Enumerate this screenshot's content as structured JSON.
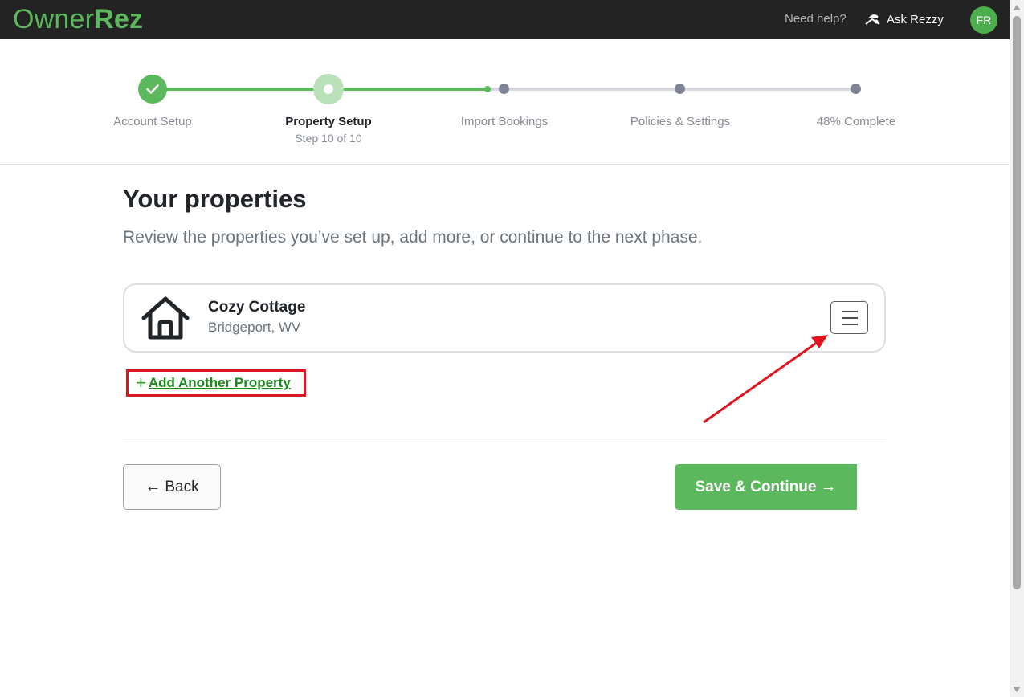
{
  "header": {
    "logo_owner": "Owner",
    "logo_rez": "Rez",
    "help_text": "Need help?",
    "ask_label": "Ask Rezzy",
    "avatar_initials": "FR",
    "brand_color": "#5cb85c"
  },
  "stepper": {
    "steps": [
      {
        "label": "Account Setup",
        "state": "complete"
      },
      {
        "label": "Property Setup",
        "state": "current",
        "sub": "Step 10 of 10"
      },
      {
        "label": "Import Bookings",
        "state": "pending"
      },
      {
        "label": "Policies & Settings",
        "state": "pending"
      },
      {
        "label": "48% Complete",
        "state": "pending"
      }
    ],
    "progress_percent": 48
  },
  "main": {
    "title": "Your properties",
    "subtitle": "Review the properties you’ve set up, add more, or continue to the next phase.",
    "properties": [
      {
        "name": "Cozy Cottage",
        "location": "Bridgeport, WV",
        "icon": "house-icon"
      }
    ],
    "add_property_label": "Add Another Property"
  },
  "footer": {
    "back_label": "Back",
    "save_label": "Save & Continue"
  }
}
